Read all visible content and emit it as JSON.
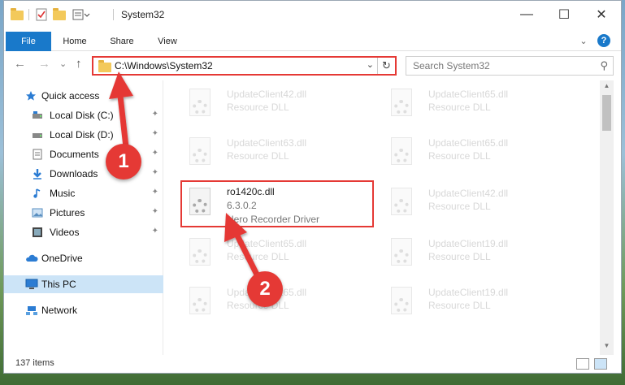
{
  "titlebar": {
    "title": "System32",
    "minimize": "—",
    "maximize": "☐",
    "close": "✕"
  },
  "ribbon": {
    "tabs": [
      "File",
      "Home",
      "Share",
      "View"
    ],
    "expand": "⌄",
    "help": "?"
  },
  "navbar": {
    "back": "←",
    "forward": "→",
    "recent": "⌄",
    "up": "↑",
    "path": "C:\\Windows\\System32",
    "dropdown": "⌄",
    "refresh": "↻",
    "search_placeholder": "Search System32",
    "search_icon": "⚲"
  },
  "sidebar": {
    "items": [
      {
        "label": "Quick access",
        "icon": "star-icon",
        "pinned": false
      },
      {
        "label": "Local Disk (C:)",
        "icon": "drive-icon",
        "pinned": true
      },
      {
        "label": "Local Disk (D:)",
        "icon": "drive-icon",
        "pinned": true
      },
      {
        "label": "Documents",
        "icon": "documents-icon",
        "pinned": true
      },
      {
        "label": "Downloads",
        "icon": "download-icon",
        "pinned": true
      },
      {
        "label": "Music",
        "icon": "music-icon",
        "pinned": true
      },
      {
        "label": "Pictures",
        "icon": "pictures-icon",
        "pinned": true
      },
      {
        "label": "Videos",
        "icon": "videos-icon",
        "pinned": true
      },
      {
        "label": "OneDrive",
        "icon": "cloud-icon",
        "pinned": false
      },
      {
        "label": "This PC",
        "icon": "pc-icon",
        "pinned": false,
        "selected": true
      },
      {
        "label": "Network",
        "icon": "network-icon",
        "pinned": false
      }
    ],
    "pin_glyph": "📌"
  },
  "files": [
    {
      "name": "UpdateClient42.dll",
      "sub": "Resource DLL",
      "faded": true
    },
    {
      "name": "UpdateClient65.dll",
      "sub": "Resource DLL",
      "faded": true
    },
    {
      "name": "UpdateClient63.dll",
      "sub": "Resource DLL",
      "faded": true
    },
    {
      "name": "UpdateClient65.dll",
      "sub": "Resource DLL",
      "faded": true
    },
    {
      "name": "ro1420c.dll",
      "version": "6.3.0.2",
      "sub": "Nero Recorder Driver",
      "faded": false
    },
    {
      "name": "UpdateClient42.dll",
      "sub": "Resource DLL",
      "faded": true
    },
    {
      "name": "UpdateClient65.dll",
      "sub": "Resource DLL",
      "faded": true
    },
    {
      "name": "UpdateClient19.dll",
      "sub": "Resource DLL",
      "faded": true
    },
    {
      "name": "UpdateClient65.dll",
      "sub": "Resource DLL",
      "faded": true
    },
    {
      "name": "UpdateClient19.dll",
      "sub": "Resource DLL",
      "faded": true
    }
  ],
  "status": {
    "item_count": "137 items"
  },
  "markers": {
    "step1": "1",
    "step2": "2"
  },
  "colors": {
    "accent": "#1979ca",
    "highlight": "#e53935",
    "selected": "#cce4f7"
  }
}
